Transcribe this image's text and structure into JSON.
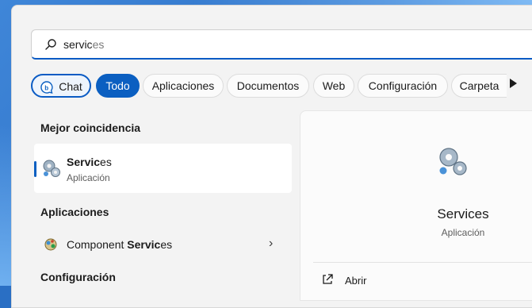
{
  "search": {
    "typed": "servic",
    "ghost": "es"
  },
  "chips": [
    {
      "label": "Chat",
      "state": "chat"
    },
    {
      "label": "Todo",
      "state": "active"
    },
    {
      "label": "Aplicaciones"
    },
    {
      "label": "Documentos"
    },
    {
      "label": "Web"
    },
    {
      "label": "Configuración"
    },
    {
      "label": "Carpeta"
    }
  ],
  "sections": {
    "best_match": "Mejor coincidencia",
    "apps": "Aplicaciones",
    "settings": "Configuración"
  },
  "best_match": {
    "name_bold": "Servic",
    "name_rest": "es",
    "type": "Aplicación"
  },
  "apps": [
    {
      "name_pre": "Component ",
      "name_bold": "Servic",
      "name_rest": "es"
    }
  ],
  "detail": {
    "title": "Services",
    "type": "Aplicación",
    "actions": [
      {
        "label": "Abrir"
      }
    ]
  },
  "colors": {
    "accent": "#0b5fc1"
  }
}
